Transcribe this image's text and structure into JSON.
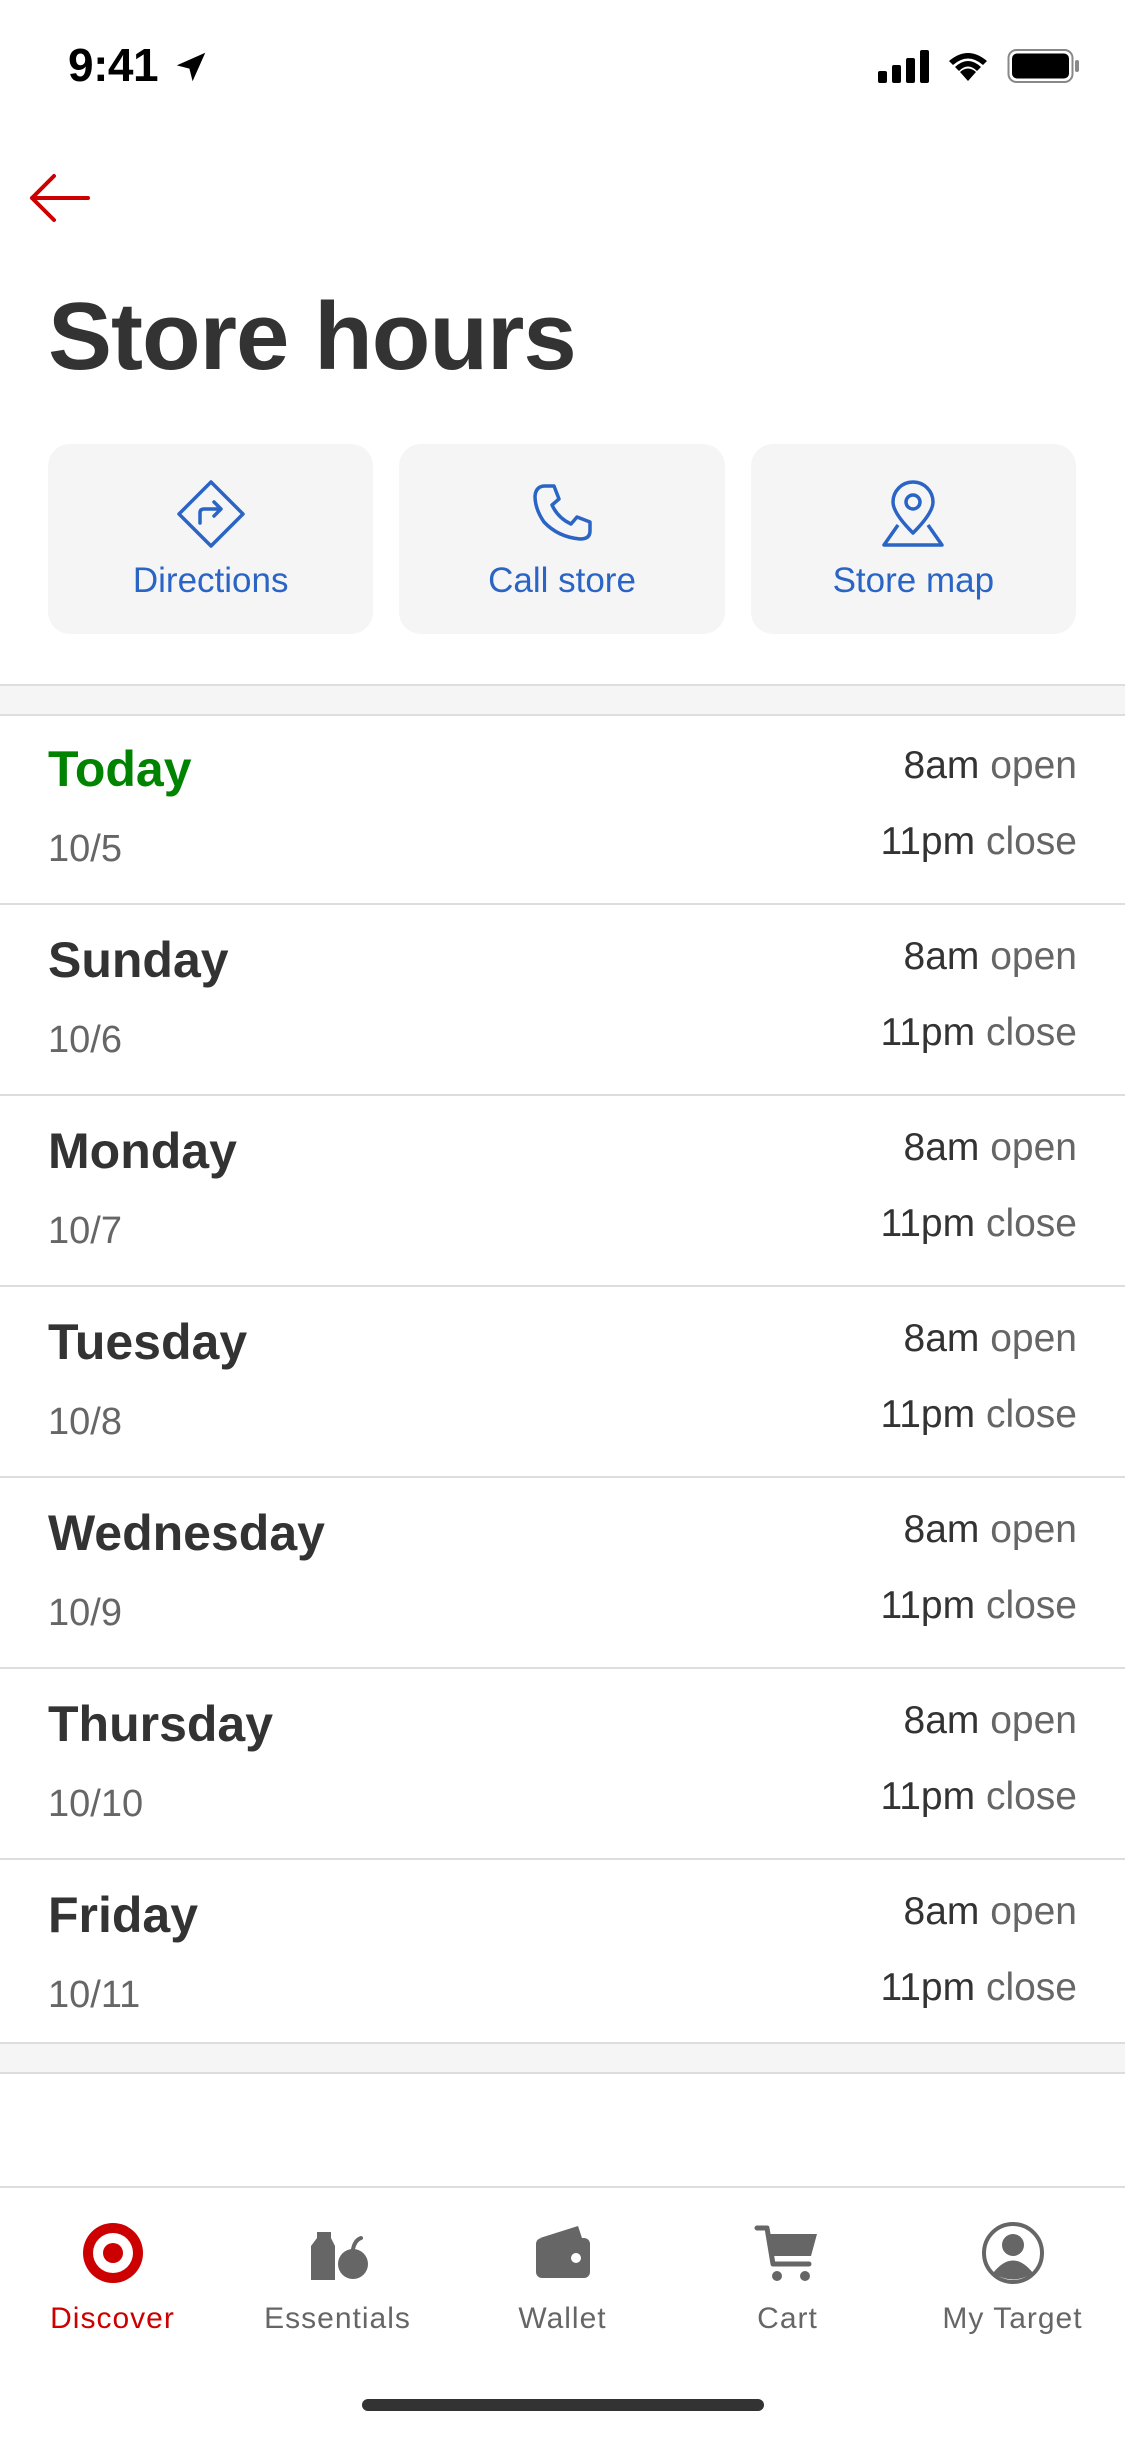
{
  "status_bar": {
    "time": "9:41"
  },
  "header": {
    "title": "Store hours"
  },
  "actions": [
    {
      "label": "Directions",
      "icon": "directions-icon"
    },
    {
      "label": "Call store",
      "icon": "phone-icon"
    },
    {
      "label": "Store map",
      "icon": "map-pin-icon"
    }
  ],
  "hours": [
    {
      "day": "Today",
      "date": "10/5",
      "open_time": "8am",
      "open_word": "open",
      "close_time": "11pm",
      "close_word": "close"
    },
    {
      "day": "Sunday",
      "date": "10/6",
      "open_time": "8am",
      "open_word": "open",
      "close_time": "11pm",
      "close_word": "close"
    },
    {
      "day": "Monday",
      "date": "10/7",
      "open_time": "8am",
      "open_word": "open",
      "close_time": "11pm",
      "close_word": "close"
    },
    {
      "day": "Tuesday",
      "date": "10/8",
      "open_time": "8am",
      "open_word": "open",
      "close_time": "11pm",
      "close_word": "close"
    },
    {
      "day": "Wednesday",
      "date": "10/9",
      "open_time": "8am",
      "open_word": "open",
      "close_time": "11pm",
      "close_word": "close"
    },
    {
      "day": "Thursday",
      "date": "10/10",
      "open_time": "8am",
      "open_word": "open",
      "close_time": "11pm",
      "close_word": "close"
    },
    {
      "day": "Friday",
      "date": "10/11",
      "open_time": "8am",
      "open_word": "open",
      "close_time": "11pm",
      "close_word": "close"
    }
  ],
  "tabs": [
    {
      "label": "Discover",
      "icon": "bullseye-icon",
      "active": true
    },
    {
      "label": "Essentials",
      "icon": "essentials-icon",
      "active": false
    },
    {
      "label": "Wallet",
      "icon": "wallet-icon",
      "active": false
    },
    {
      "label": "Cart",
      "icon": "cart-icon",
      "active": false
    },
    {
      "label": "My Target",
      "icon": "profile-icon",
      "active": false
    }
  ],
  "colors": {
    "brand_red": "#cc0000",
    "today_green": "#008300",
    "action_blue": "#2a64c5",
    "text_dark": "#333333",
    "text_muted": "#666666"
  }
}
